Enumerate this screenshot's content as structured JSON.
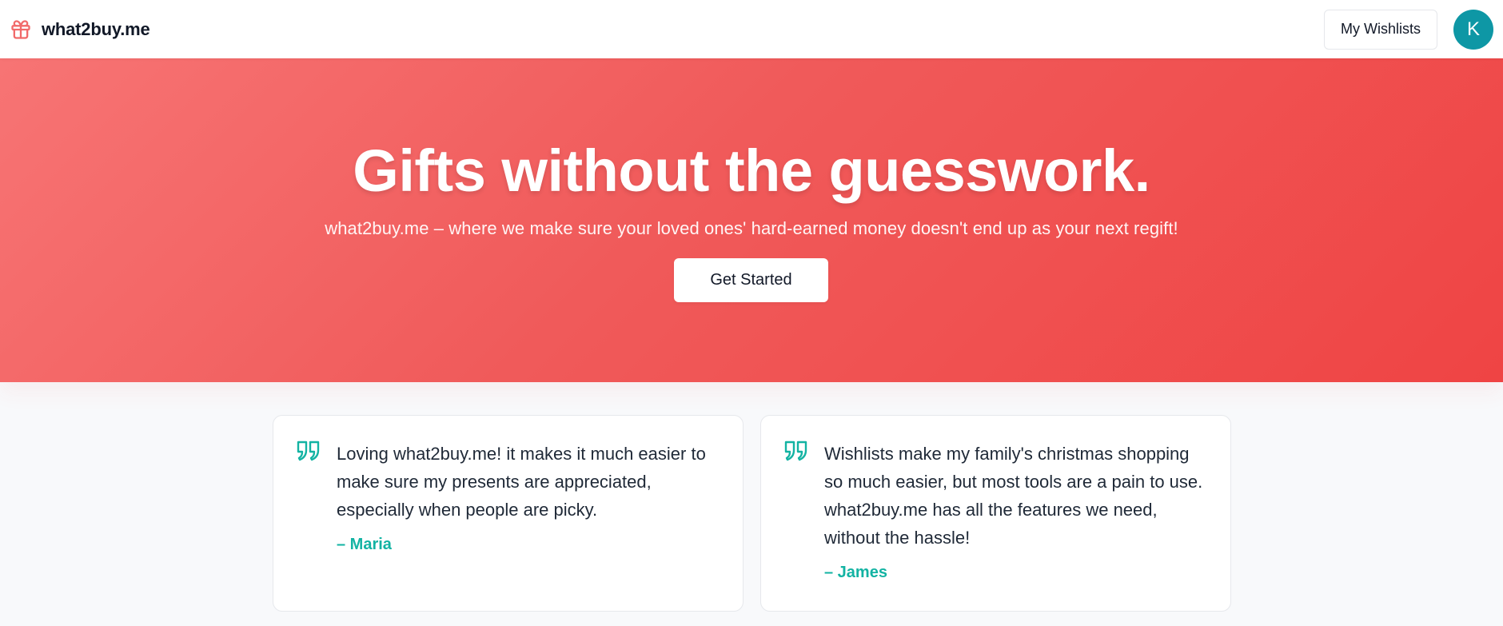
{
  "header": {
    "brand_name": "what2buy.me",
    "brand_icon": "gift-icon",
    "my_wishlists_label": "My Wishlists",
    "avatar_initial": "K"
  },
  "hero": {
    "title": "Gifts without the guesswork.",
    "subtitle": "what2buy.me – where we make sure your loved ones' hard-earned money doesn't end up as your next regift!",
    "cta_label": "Get Started"
  },
  "testimonials": [
    {
      "quote": "Loving what2buy.me! it makes it much easier to make sure my presents are appreciated, especially when people are picky.",
      "author": "– Maria"
    },
    {
      "quote": "Wishlists make my family's christmas shopping so much easier, but most tools are a pain to use. what2buy.me has all the features we need, without the hassle!",
      "author": "– James"
    }
  ],
  "colors": {
    "hero_gradient_start": "#f77474",
    "hero_gradient_end": "#ef4444",
    "accent_teal": "#13b3a3",
    "avatar_bg": "#0e97a5",
    "brand_icon_color": "#f16a6a"
  }
}
